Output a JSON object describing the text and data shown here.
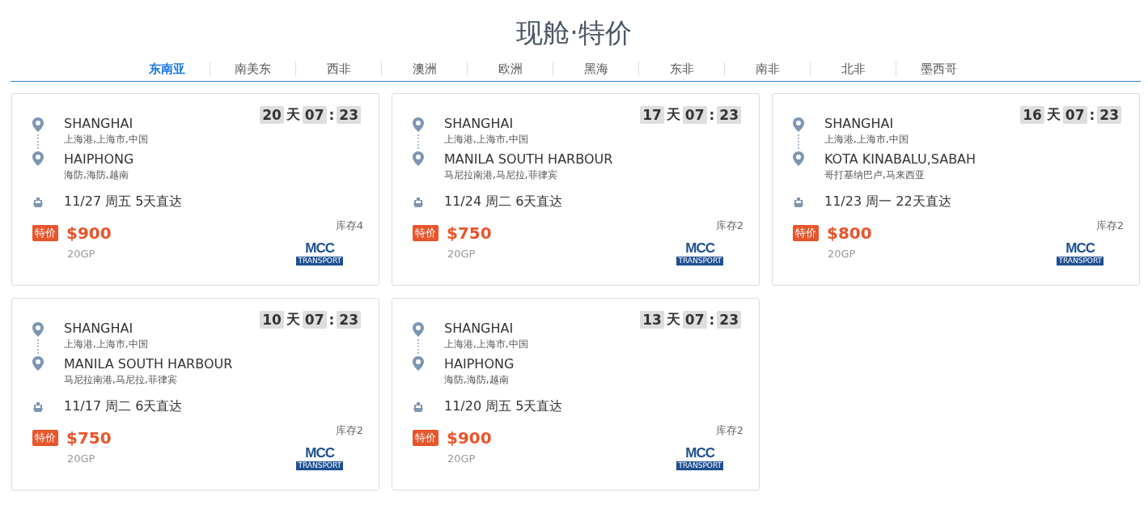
{
  "title": "现舱·特价",
  "tabs": [
    {
      "label": "东南亚",
      "selected": true
    },
    {
      "label": "南美东",
      "selected": false
    },
    {
      "label": "西非",
      "selected": false
    },
    {
      "label": "澳洲",
      "selected": false
    },
    {
      "label": "欧洲",
      "selected": false
    },
    {
      "label": "黑海",
      "selected": false
    },
    {
      "label": "东非",
      "selected": false
    },
    {
      "label": "南非",
      "selected": false
    },
    {
      "label": "北非",
      "selected": false
    },
    {
      "label": "墨西哥",
      "selected": false
    }
  ],
  "cards": [
    {
      "countdown": {
        "days": "20",
        "day_unit": "天",
        "hours": "07",
        "sep": ":",
        "minutes": "23"
      },
      "origin": {
        "name": "SHANGHAI",
        "detail": "上海港,上海市,中国"
      },
      "destination": {
        "name": "HAIPHONG",
        "detail": "海防,海防,越南"
      },
      "schedule": "11/27 周五 5天直达",
      "badge": "特价",
      "price": "$900",
      "container": "20GP",
      "stock": "库存4",
      "carrier": {
        "name": "MCC",
        "sub": "TRANSPORT"
      }
    },
    {
      "countdown": {
        "days": "17",
        "day_unit": "天",
        "hours": "07",
        "sep": ":",
        "minutes": "23"
      },
      "origin": {
        "name": "SHANGHAI",
        "detail": "上海港,上海市,中国"
      },
      "destination": {
        "name": "MANILA SOUTH HARBOUR",
        "detail": "马尼拉南港,马尼拉,菲律宾"
      },
      "schedule": "11/24 周二 6天直达",
      "badge": "特价",
      "price": "$750",
      "container": "20GP",
      "stock": "库存2",
      "carrier": {
        "name": "MCC",
        "sub": "TRANSPORT"
      }
    },
    {
      "countdown": {
        "days": "16",
        "day_unit": "天",
        "hours": "07",
        "sep": ":",
        "minutes": "23"
      },
      "origin": {
        "name": "SHANGHAI",
        "detail": "上海港,上海市,中国"
      },
      "destination": {
        "name": "KOTA KINABALU,SABAH",
        "detail": "哥打基纳巴卢,马来西亚"
      },
      "schedule": "11/23 周一 22天直达",
      "badge": "特价",
      "price": "$800",
      "container": "20GP",
      "stock": "库存2",
      "carrier": {
        "name": "MCC",
        "sub": "TRANSPORT"
      }
    },
    {
      "countdown": {
        "days": "10",
        "day_unit": "天",
        "hours": "07",
        "sep": ":",
        "minutes": "23"
      },
      "origin": {
        "name": "SHANGHAI",
        "detail": "上海港,上海市,中国"
      },
      "destination": {
        "name": "MANILA SOUTH HARBOUR",
        "detail": "马尼拉南港,马尼拉,菲律宾"
      },
      "schedule": "11/17 周二 6天直达",
      "badge": "特价",
      "price": "$750",
      "container": "20GP",
      "stock": "库存2",
      "carrier": {
        "name": "MCC",
        "sub": "TRANSPORT"
      }
    },
    {
      "countdown": {
        "days": "13",
        "day_unit": "天",
        "hours": "07",
        "sep": ":",
        "minutes": "23"
      },
      "origin": {
        "name": "SHANGHAI",
        "detail": "上海港,上海市,中国"
      },
      "destination": {
        "name": "HAIPHONG",
        "detail": "海防,海防,越南"
      },
      "schedule": "11/20 周五 5天直达",
      "badge": "特价",
      "price": "$900",
      "container": "20GP",
      "stock": "库存2",
      "carrier": {
        "name": "MCC",
        "sub": "TRANSPORT"
      }
    }
  ]
}
